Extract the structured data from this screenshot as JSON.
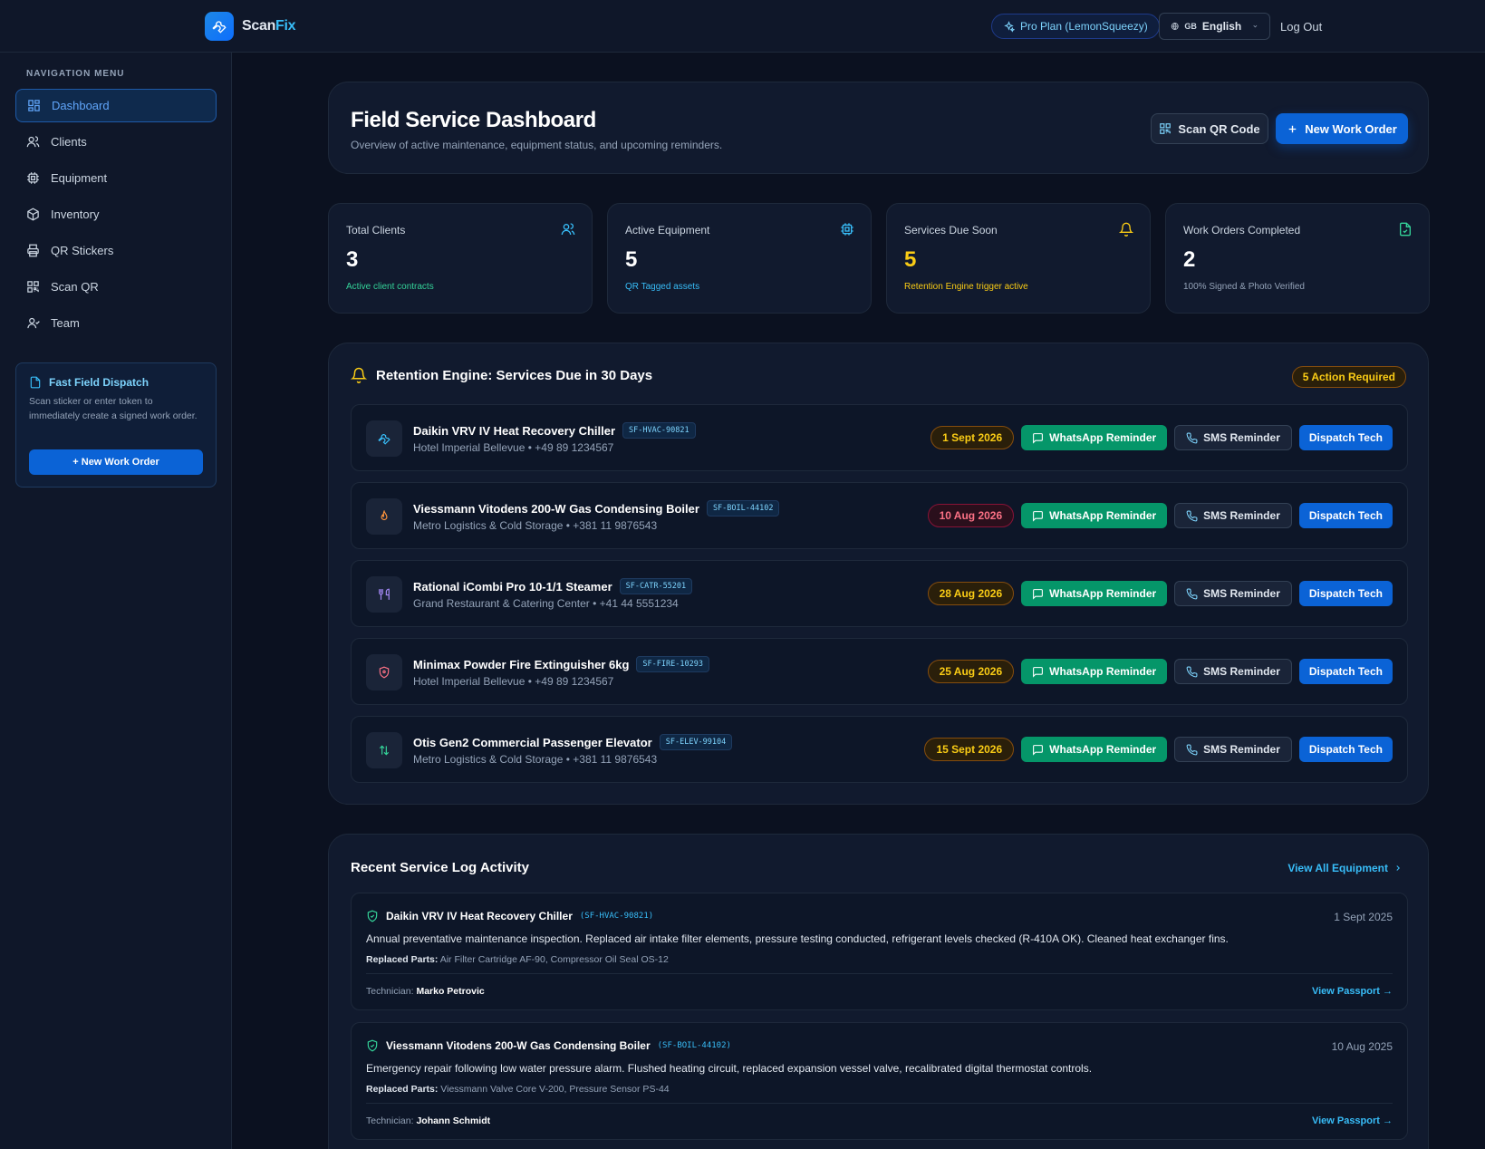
{
  "app": {
    "name_main": "Scan",
    "name_accent": "Fix"
  },
  "header": {
    "plan": "Pro Plan (LemonSqueezy)",
    "lang_flag": "GB",
    "lang_label": "English",
    "logout": "Log Out"
  },
  "sidebar": {
    "title": "NAVIGATION MENU",
    "items": [
      {
        "label": "Dashboard",
        "icon": "dashboard-icon"
      },
      {
        "label": "Clients",
        "icon": "users-icon"
      },
      {
        "label": "Equipment",
        "icon": "cpu-icon"
      },
      {
        "label": "Inventory",
        "icon": "package-icon"
      },
      {
        "label": "QR Stickers",
        "icon": "printer-icon"
      },
      {
        "label": "Scan QR",
        "icon": "qr-icon"
      },
      {
        "label": "Team",
        "icon": "user-check-icon"
      }
    ],
    "dispatch": {
      "title": "Fast Field Dispatch",
      "desc": "Scan sticker or enter token to immediately create a signed work order.",
      "button": "+ New Work Order"
    }
  },
  "hero": {
    "title": "Field Service Dashboard",
    "subtitle": "Overview of active maintenance, equipment status, and upcoming reminders.",
    "scan_button": "Scan QR Code",
    "new_button": "New Work Order"
  },
  "stats": [
    {
      "label": "Total Clients",
      "value": "3",
      "note": "Active client contracts",
      "color": "#34d399"
    },
    {
      "label": "Active Equipment",
      "value": "5",
      "note": "QR Tagged assets",
      "color": "#38bdf8"
    },
    {
      "label": "Services Due Soon",
      "value": "5",
      "note": "Retention Engine trigger active",
      "color": "#facc15"
    },
    {
      "label": "Work Orders Completed",
      "value": "2",
      "note": "100% Signed & Photo Verified",
      "color": "#94a3b8"
    }
  ],
  "retention": {
    "title": "Retention Engine: Services Due in 30 Days",
    "badge": "5 Action Required",
    "whatsapp": "WhatsApp Reminder",
    "sms": "SMS Reminder",
    "dispatch": "Dispatch Tech",
    "rows": [
      {
        "name": "Daikin VRV IV Heat Recovery Chiller",
        "code": "SF-HVAC-90821",
        "sub": "Hotel Imperial Bellevue • +49 89 1234567",
        "date": "1 Sept 2026",
        "status": "amber",
        "icon": "wrench-icon"
      },
      {
        "name": "Viessmann Vitodens 200-W Gas Condensing Boiler",
        "code": "SF-BOIL-44102",
        "sub": "Metro Logistics & Cold Storage • +381 11 9876543",
        "date": "10 Aug 2026",
        "status": "red",
        "icon": "flame-icon"
      },
      {
        "name": "Rational iCombi Pro 10-1/1 Steamer",
        "code": "SF-CATR-55201",
        "sub": "Grand Restaurant & Catering Center • +41 44 5551234",
        "date": "28 Aug 2026",
        "status": "amber",
        "icon": "utensils-icon"
      },
      {
        "name": "Minimax Powder Fire Extinguisher 6kg",
        "code": "SF-FIRE-10293",
        "sub": "Hotel Imperial Bellevue • +49 89 1234567",
        "date": "25 Aug 2026",
        "status": "amber",
        "icon": "shield-icon"
      },
      {
        "name": "Otis Gen2 Commercial Passenger Elevator",
        "code": "SF-ELEV-99104",
        "sub": "Metro Logistics & Cold Storage • +381 11 9876543",
        "date": "15 Sept 2026",
        "status": "amber",
        "icon": "arrows-updown-icon"
      }
    ]
  },
  "recent": {
    "title": "Recent Service Log Activity",
    "view_all": "View All Equipment",
    "parts_label": "Replaced Parts:",
    "tech_label": "Technician:",
    "passport": "View Passport →",
    "logs": [
      {
        "name": "Daikin VRV IV Heat Recovery Chiller",
        "code": "(SF-HVAC-90821)",
        "date": "1 Sept 2025",
        "desc": "Annual preventative maintenance inspection. Replaced air intake filter elements, pressure testing conducted, refrigerant levels checked (R-410A OK). Cleaned heat exchanger fins.",
        "parts": "Air Filter Cartridge AF-90, Compressor Oil Seal OS-12",
        "tech": "Marko Petrovic"
      },
      {
        "name": "Viessmann Vitodens 200-W Gas Condensing Boiler",
        "code": "(SF-BOIL-44102)",
        "date": "10 Aug 2025",
        "desc": "Emergency repair following low water pressure alarm. Flushed heating circuit, replaced expansion vessel valve, recalibrated digital thermostat controls.",
        "parts": "Viessmann Valve Core V-200, Pressure Sensor PS-44",
        "tech": "Johann Schmidt"
      }
    ]
  }
}
